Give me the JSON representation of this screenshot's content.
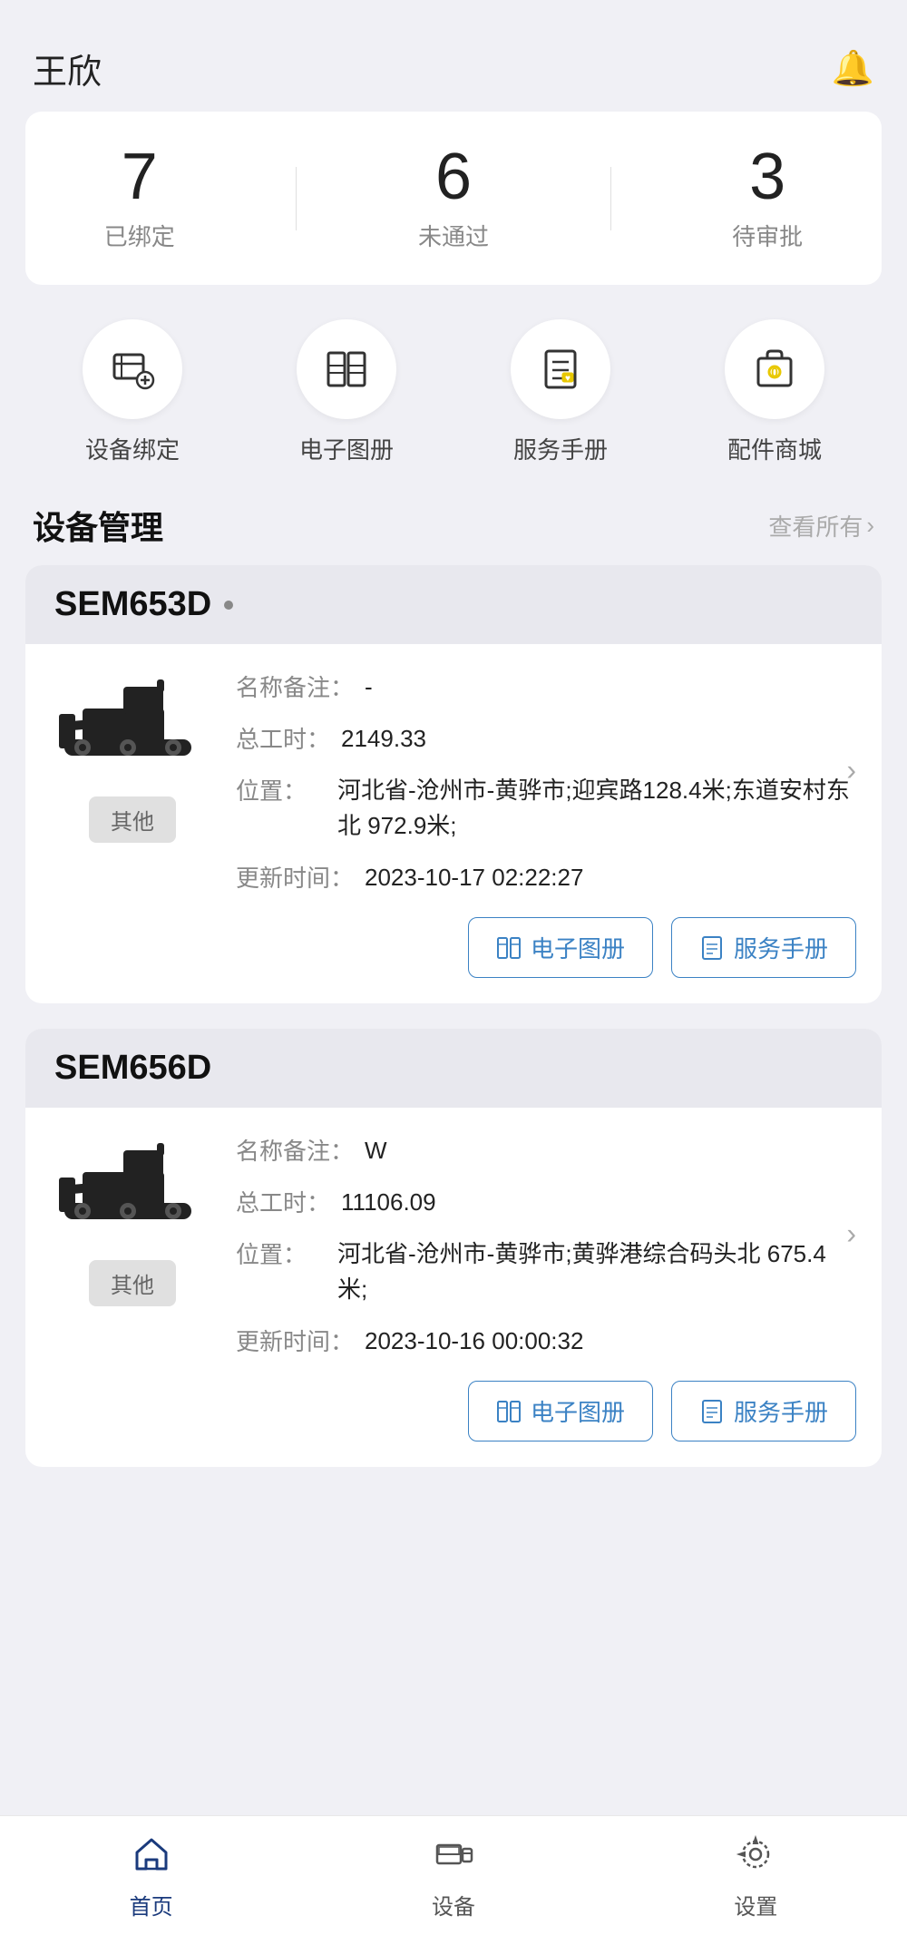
{
  "header": {
    "user": "王欣",
    "bell_icon": "🔔"
  },
  "stats": {
    "items": [
      {
        "number": "7",
        "label": "已绑定"
      },
      {
        "number": "6",
        "label": "未通过"
      },
      {
        "number": "3",
        "label": "待审批"
      }
    ]
  },
  "quick_actions": [
    {
      "id": "device-bind",
      "label": "设备绑定"
    },
    {
      "id": "e-manual",
      "label": "电子图册"
    },
    {
      "id": "service-manual",
      "label": "服务手册"
    },
    {
      "id": "parts-shop",
      "label": "配件商城"
    }
  ],
  "device_management": {
    "title": "设备管理",
    "view_all": "查看所有"
  },
  "devices": [
    {
      "model": "SEM653D",
      "name_note_label": "名称备注：",
      "name_note_value": "-",
      "hours_label": "总工时：",
      "hours_value": "2149.33",
      "location_label": "位置：",
      "location_value": "河北省-沧州市-黄骅市;迎宾路128.4米;东道安村东北 972.9米;",
      "update_label": "更新时间：",
      "update_value": "2023-10-17 02:22:27",
      "tag": "其他",
      "btn1": "电子图册",
      "btn2": "服务手册"
    },
    {
      "model": "SEM656D",
      "name_note_label": "名称备注：",
      "name_note_value": "W",
      "hours_label": "总工时：",
      "hours_value": "11106.09",
      "location_label": "位置：",
      "location_value": "河北省-沧州市-黄骅市;黄骅港综合码头北 675.4米;",
      "update_label": "更新时间：",
      "update_value": "2023-10-16 00:00:32",
      "tag": "其他",
      "btn1": "电子图册",
      "btn2": "服务手册"
    }
  ],
  "bottom_nav": [
    {
      "id": "home",
      "label": "首页",
      "active": true
    },
    {
      "id": "device",
      "label": "设备",
      "active": false
    },
    {
      "id": "settings",
      "label": "设置",
      "active": false
    }
  ],
  "system_nav": [
    "|||",
    "○",
    "<"
  ]
}
